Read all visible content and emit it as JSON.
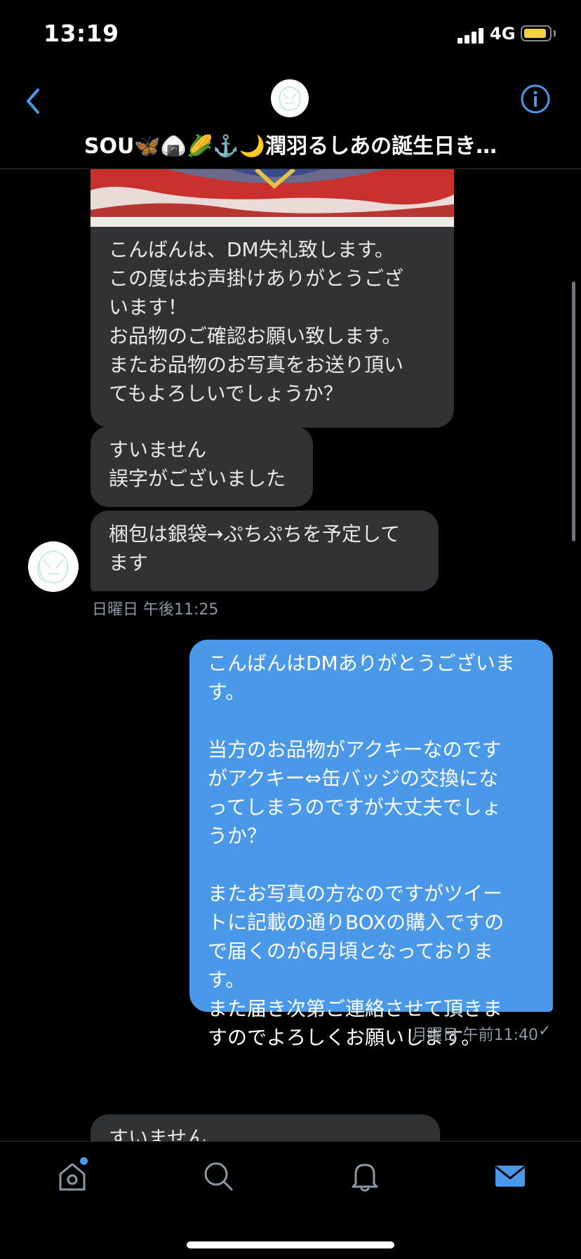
{
  "status_bar": {
    "time": "13:19",
    "network": "4G"
  },
  "header": {
    "title": "SOU🦋🍙🌽⚓️🌙潤羽るしあの誕生日き…"
  },
  "messages": [
    {
      "text": "こんばんは、DM失礼致します。\nこの度はお声掛けありがとうござ\nいます！\nお品物のご確認お願い致します。\nまたお品物のお写真をお送り頂い\nてもよろしいでしょうか？"
    },
    {
      "text": "すいません\n誤字がございました"
    },
    {
      "text": "梱包は銀袋→ぷちぷちを予定して\nます"
    },
    {
      "text": "こんばんはDMありがとうございま\nす。\n\n当方のお品物がアクキーなのです\nがアクキー⇔缶バッジの交換にな\nってしまうのですが大丈夫でしょ\nうか？\n\nまたお写真の方なのですがツイー\nトに記載の通りBOXの購入ですの\nで届くのが6月頃となっておりま\nす。\nまた届き次第ご連絡させて頂きま\nすのでよろしくお願いします。"
    },
    {
      "text": "すいません"
    }
  ],
  "timestamps": {
    "received": "日曜日 午後11:25",
    "sent": "月曜日 午前11:40"
  },
  "read_receipt": "✓",
  "tabs": [
    "home-icon",
    "search-icon",
    "notifications-icon",
    "messages-icon"
  ],
  "colors": {
    "accent": "#4a98e8",
    "received_bubble": "#2f3336",
    "background": "#000000"
  }
}
